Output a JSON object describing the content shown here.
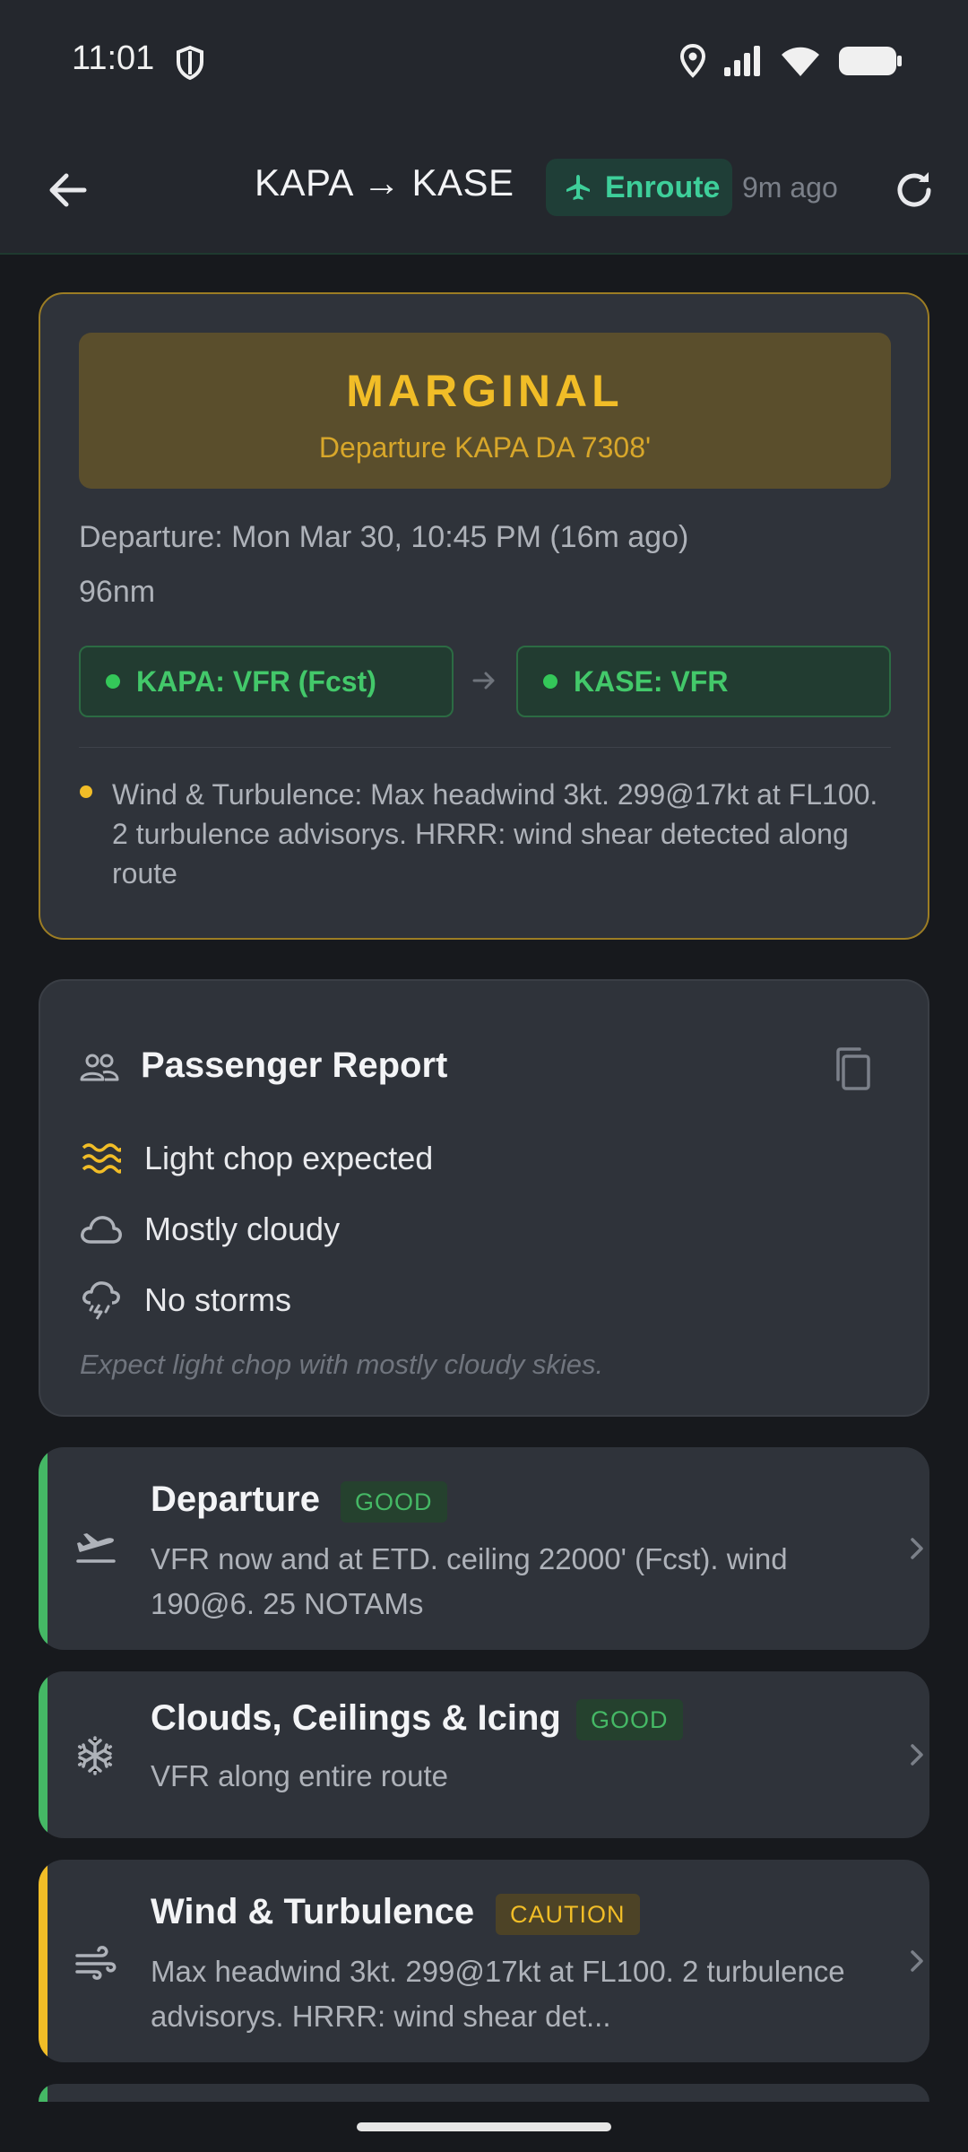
{
  "status_bar": {
    "time": "11:01"
  },
  "header": {
    "route": "KAPA → KASE",
    "status_badge": "Enroute",
    "updated": "9m ago"
  },
  "summary": {
    "rating": "MARGINAL",
    "rating_detail": "Departure KAPA DA 7308'",
    "departure_time": "Departure: Mon Mar 30, 10:45 PM (16m ago)",
    "distance": "96nm",
    "departure_category": "KAPA: VFR (Fcst)",
    "arrival_category": "KASE: VFR",
    "alert": "Wind & Turbulence: Max headwind 3kt. 299@17kt at FL100. 2 turbulence advisorys. HRRR: wind shear detected along route"
  },
  "passenger_report": {
    "title": "Passenger Report",
    "items": [
      {
        "icon": "waves-icon",
        "text": "Light chop expected"
      },
      {
        "icon": "cloud-icon",
        "text": "Mostly cloudy"
      },
      {
        "icon": "storm-icon",
        "text": "No storms"
      }
    ],
    "summary": "Expect light chop with mostly cloudy skies."
  },
  "sections": [
    {
      "title": "Departure",
      "badge": "GOOD",
      "description": "VFR now and at ETD. ceiling 22000' (Fcst). wind 190@6. 25 NOTAMs",
      "icon": "takeoff-icon"
    },
    {
      "title": "Clouds, Ceilings & Icing",
      "badge": "GOOD",
      "description": "VFR along entire route",
      "icon": "snowflake-icon"
    },
    {
      "title": "Wind & Turbulence",
      "badge": "CAUTION",
      "description": "Max headwind 3kt. 299@17kt at FL100. 2 turbulence advisorys. HRRR: wind shear det...",
      "icon": "wind-icon"
    }
  ],
  "colors": {
    "accent_green": "#3ecf9a",
    "marginal": "#f1bd27",
    "good": "#45b865",
    "caution": "#f1bd27"
  }
}
